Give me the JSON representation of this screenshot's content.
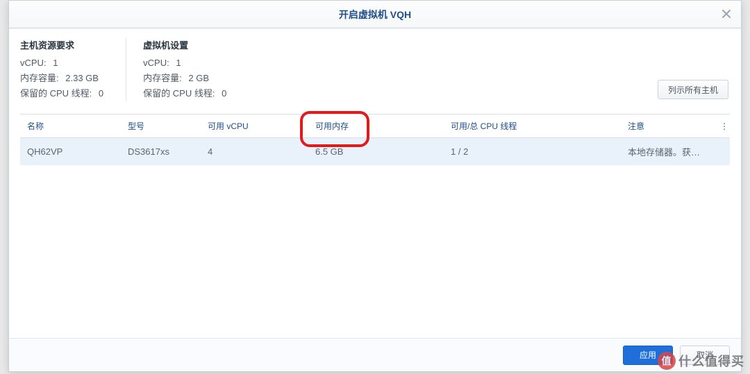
{
  "dialog": {
    "title": "开启虚拟机 VQH",
    "close_label": "关闭"
  },
  "host_req": {
    "heading": "主机资源要求",
    "vcpu_label": "vCPU:",
    "vcpu_value": "1",
    "mem_label": "内存容量:",
    "mem_value": "2.33 GB",
    "reserved_label": "保留的 CPU 线程:",
    "reserved_value": "0"
  },
  "vm_settings": {
    "heading": "虚拟机设置",
    "vcpu_label": "vCPU:",
    "vcpu_value": "1",
    "mem_label": "内存容量:",
    "mem_value": "2 GB",
    "reserved_label": "保留的 CPU 线程:",
    "reserved_value": "0"
  },
  "buttons": {
    "list_all_hosts": "列示所有主机",
    "apply": "应用",
    "cancel": "取消"
  },
  "table": {
    "columns": {
      "name": "名称",
      "model": "型号",
      "vcpu": "可用 vCPU",
      "mem": "可用内存",
      "threads": "可用/总 CPU 线程",
      "note": "注意",
      "more": "⋮"
    },
    "rows": [
      {
        "name": "QH62VP",
        "model": "DS3617xs",
        "vcpu": "4",
        "mem": "6.5 GB",
        "threads": "1 / 2",
        "note": "本地存储器。获得..."
      }
    ]
  },
  "watermark": {
    "badge": "值",
    "text": "什么值得买"
  }
}
